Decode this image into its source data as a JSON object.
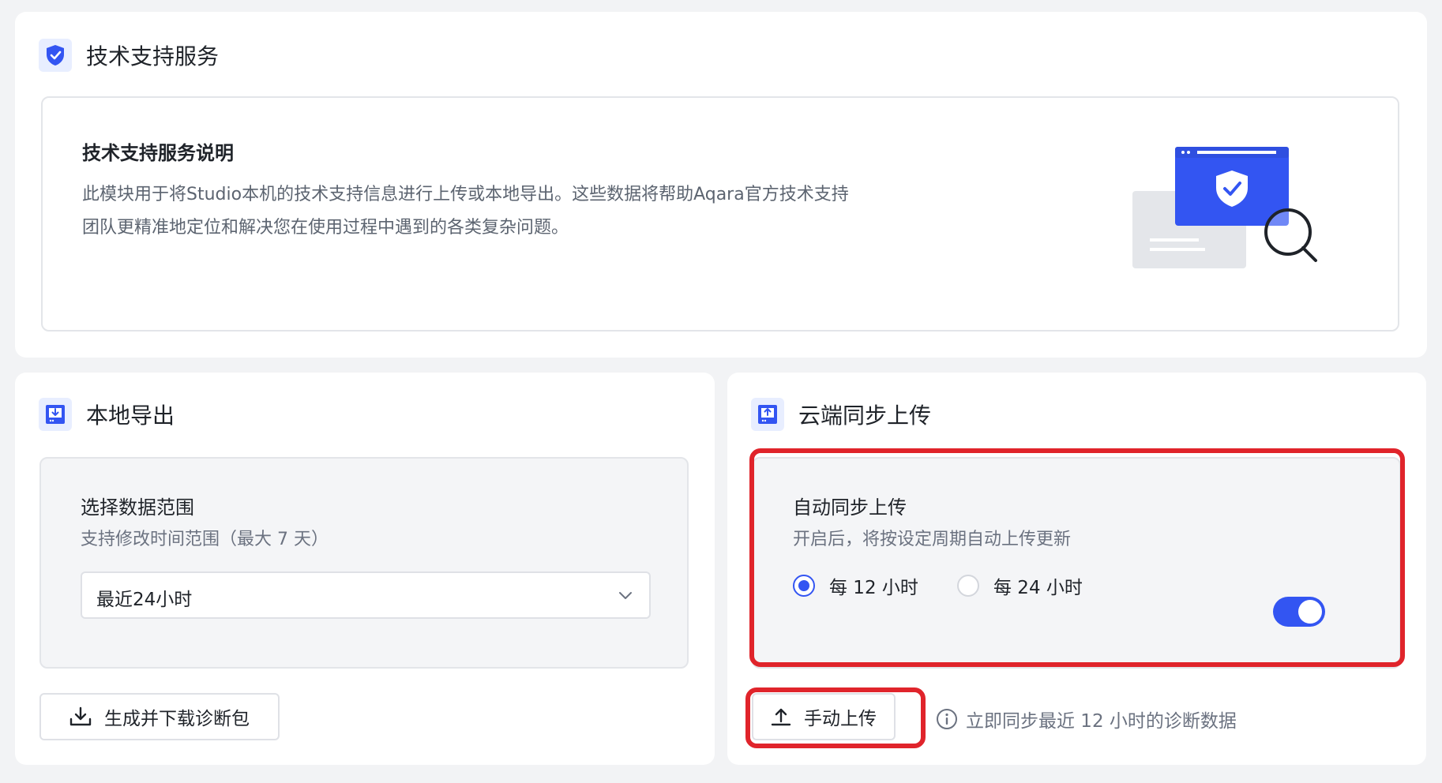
{
  "support": {
    "title": "技术支持服务",
    "desc_title": "技术支持服务说明",
    "desc_line1": "此模块用于将Studio本机的技术支持信息进行上传或本地导出。这些数据将帮助Aqara官方技术支持",
    "desc_line2": "团队更精准地定位和解决您在使用过程中遇到的各类复杂问题。"
  },
  "local_export": {
    "title": "本地导出",
    "range_label": "选择数据范围",
    "range_hint": "支持修改时间范围（最大 7 天）",
    "range_value": "最近24小时",
    "generate_button": "生成并下载诊断包"
  },
  "cloud_upload": {
    "title": "云端同步上传",
    "auto_label": "自动同步上传",
    "auto_hint": "开启后，将按设定周期自动上传更新",
    "auto_enabled": true,
    "options": [
      "每 12 小时",
      "每 24 小时"
    ],
    "selected_option": "每 12 小时",
    "manual_button": "手动上传",
    "manual_hint": "立即同步最近 12 小时的诊断数据"
  },
  "colors": {
    "accent": "#3355f2",
    "highlight": "#e0242b"
  }
}
